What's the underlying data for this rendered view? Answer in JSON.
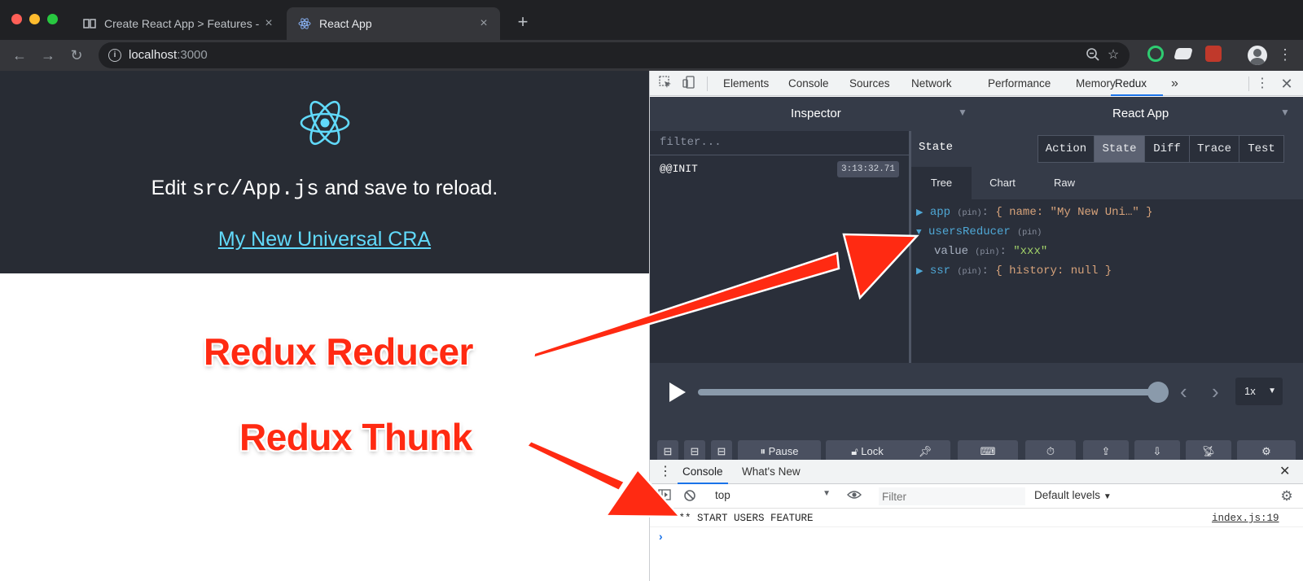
{
  "browser": {
    "tabs": [
      {
        "title": "Create React App > Features -",
        "active": false
      },
      {
        "title": "React App",
        "active": true
      }
    ],
    "url_host": "localhost",
    "url_port": ":3000"
  },
  "page": {
    "edit_prefix": "Edit ",
    "edit_code": "src/App.js",
    "edit_suffix": " and save to reload.",
    "link_text": "My New Universal CRA"
  },
  "annotations": {
    "reducer": "Redux Reducer",
    "thunk": "Redux Thunk"
  },
  "devtools": {
    "tabs": [
      "Elements",
      "Console",
      "Sources",
      "Network",
      "Performance",
      "Memory",
      "Redux"
    ],
    "more": "»",
    "redux": {
      "left_title": "Inspector",
      "right_title": "React App",
      "filter_placeholder": "filter...",
      "actions": [
        {
          "name": "@@INIT",
          "time": "3:13:32.71"
        }
      ],
      "state_label": "State",
      "modes": [
        "Action",
        "State",
        "Diff",
        "Trace",
        "Test"
      ],
      "active_mode": "State",
      "subtabs": [
        "Tree",
        "Chart",
        "Raw"
      ],
      "tree": {
        "app_key": "app",
        "app_value": "{ name: \"My New Uni…\" }",
        "reducer_key": "usersReducer",
        "value_key": "value",
        "value_value": "\"xxx\"",
        "ssr_key": "ssr",
        "ssr_value": "{ history: null }",
        "pin": "(pin)"
      },
      "speed": "1x",
      "buttons": {
        "pause": "Pause",
        "lock": "Lock"
      }
    },
    "drawer": {
      "tabs": [
        "Console",
        "What's New"
      ],
      "context": "top",
      "filter_placeholder": "Filter",
      "levels": "Default levels",
      "log_message": "*** START USERS FEATURE",
      "log_source": "index.js:19"
    }
  },
  "colors": {
    "annotation": "#ff2a12",
    "react_cyan": "#61dafb",
    "app_bg": "#282c34",
    "redux_bg": "#2a2f3a"
  }
}
